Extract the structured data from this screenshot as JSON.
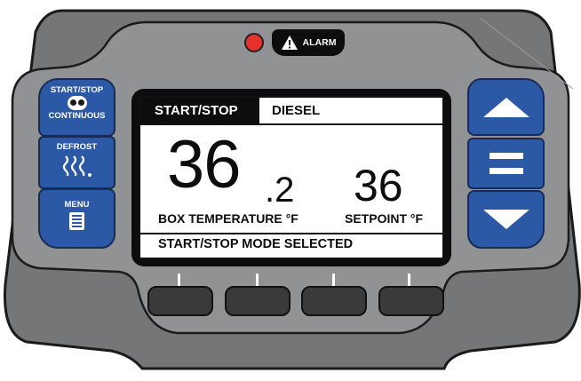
{
  "alarm": {
    "label": "ALARM",
    "led_color": "#e5322b"
  },
  "left_buttons": {
    "startstop": {
      "line1": "START/STOP",
      "line2": "CONTINUOUS"
    },
    "defrost": {
      "label": "DEFROST"
    },
    "menu": {
      "label": "MENU"
    }
  },
  "right_buttons": {
    "up": "arrow-up-icon",
    "enter": "equals-icon",
    "down": "arrow-down-icon"
  },
  "display": {
    "mode_tab": "START/STOP",
    "fuel_tab": "DIESEL",
    "box_temp_int": "36",
    "box_temp_dec": ".2",
    "box_temp_label": "BOX TEMPERATURE °F",
    "setpoint_value": "36",
    "setpoint_label": "SETPOINT °F",
    "status_message": "START/STOP MODE SELECTED"
  },
  "colors": {
    "panel": "#747678",
    "panel_light": "#909294",
    "button_blue": "#2b59a6",
    "lcd_bg": "#ffffff"
  }
}
